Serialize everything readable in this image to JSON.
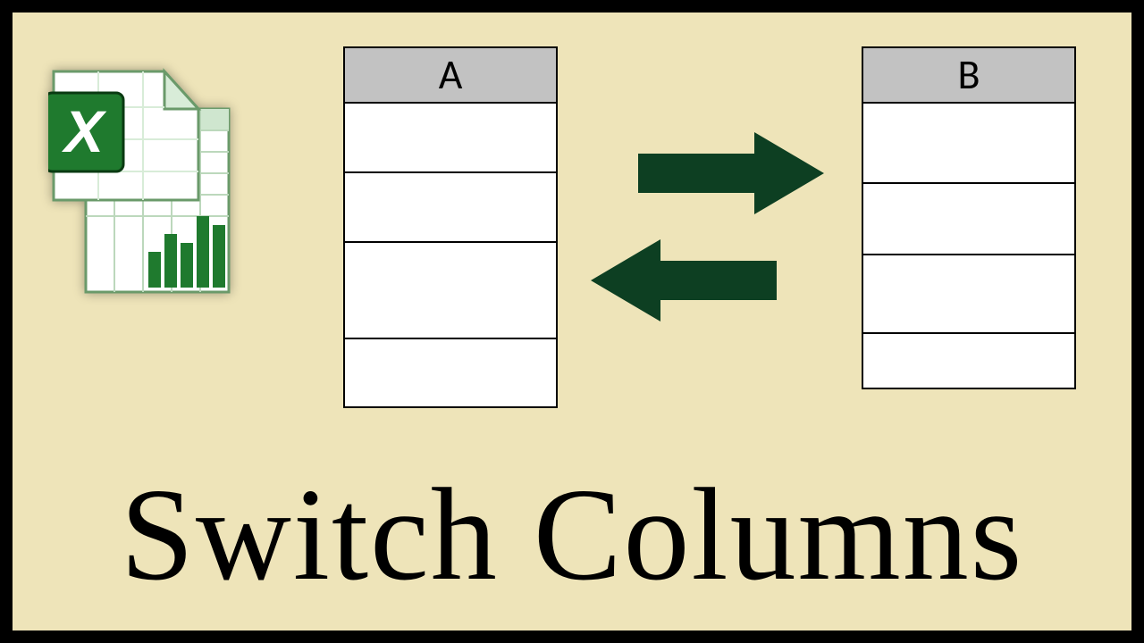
{
  "columns": {
    "a_label": "A",
    "b_label": "B"
  },
  "title_text": "Switch Columns",
  "icon": {
    "letter": "X"
  },
  "colors": {
    "background": "#eee4b9",
    "arrow": "#0d3f22",
    "excel_green": "#1f7a2e",
    "header_gray": "#c2c2c2"
  }
}
